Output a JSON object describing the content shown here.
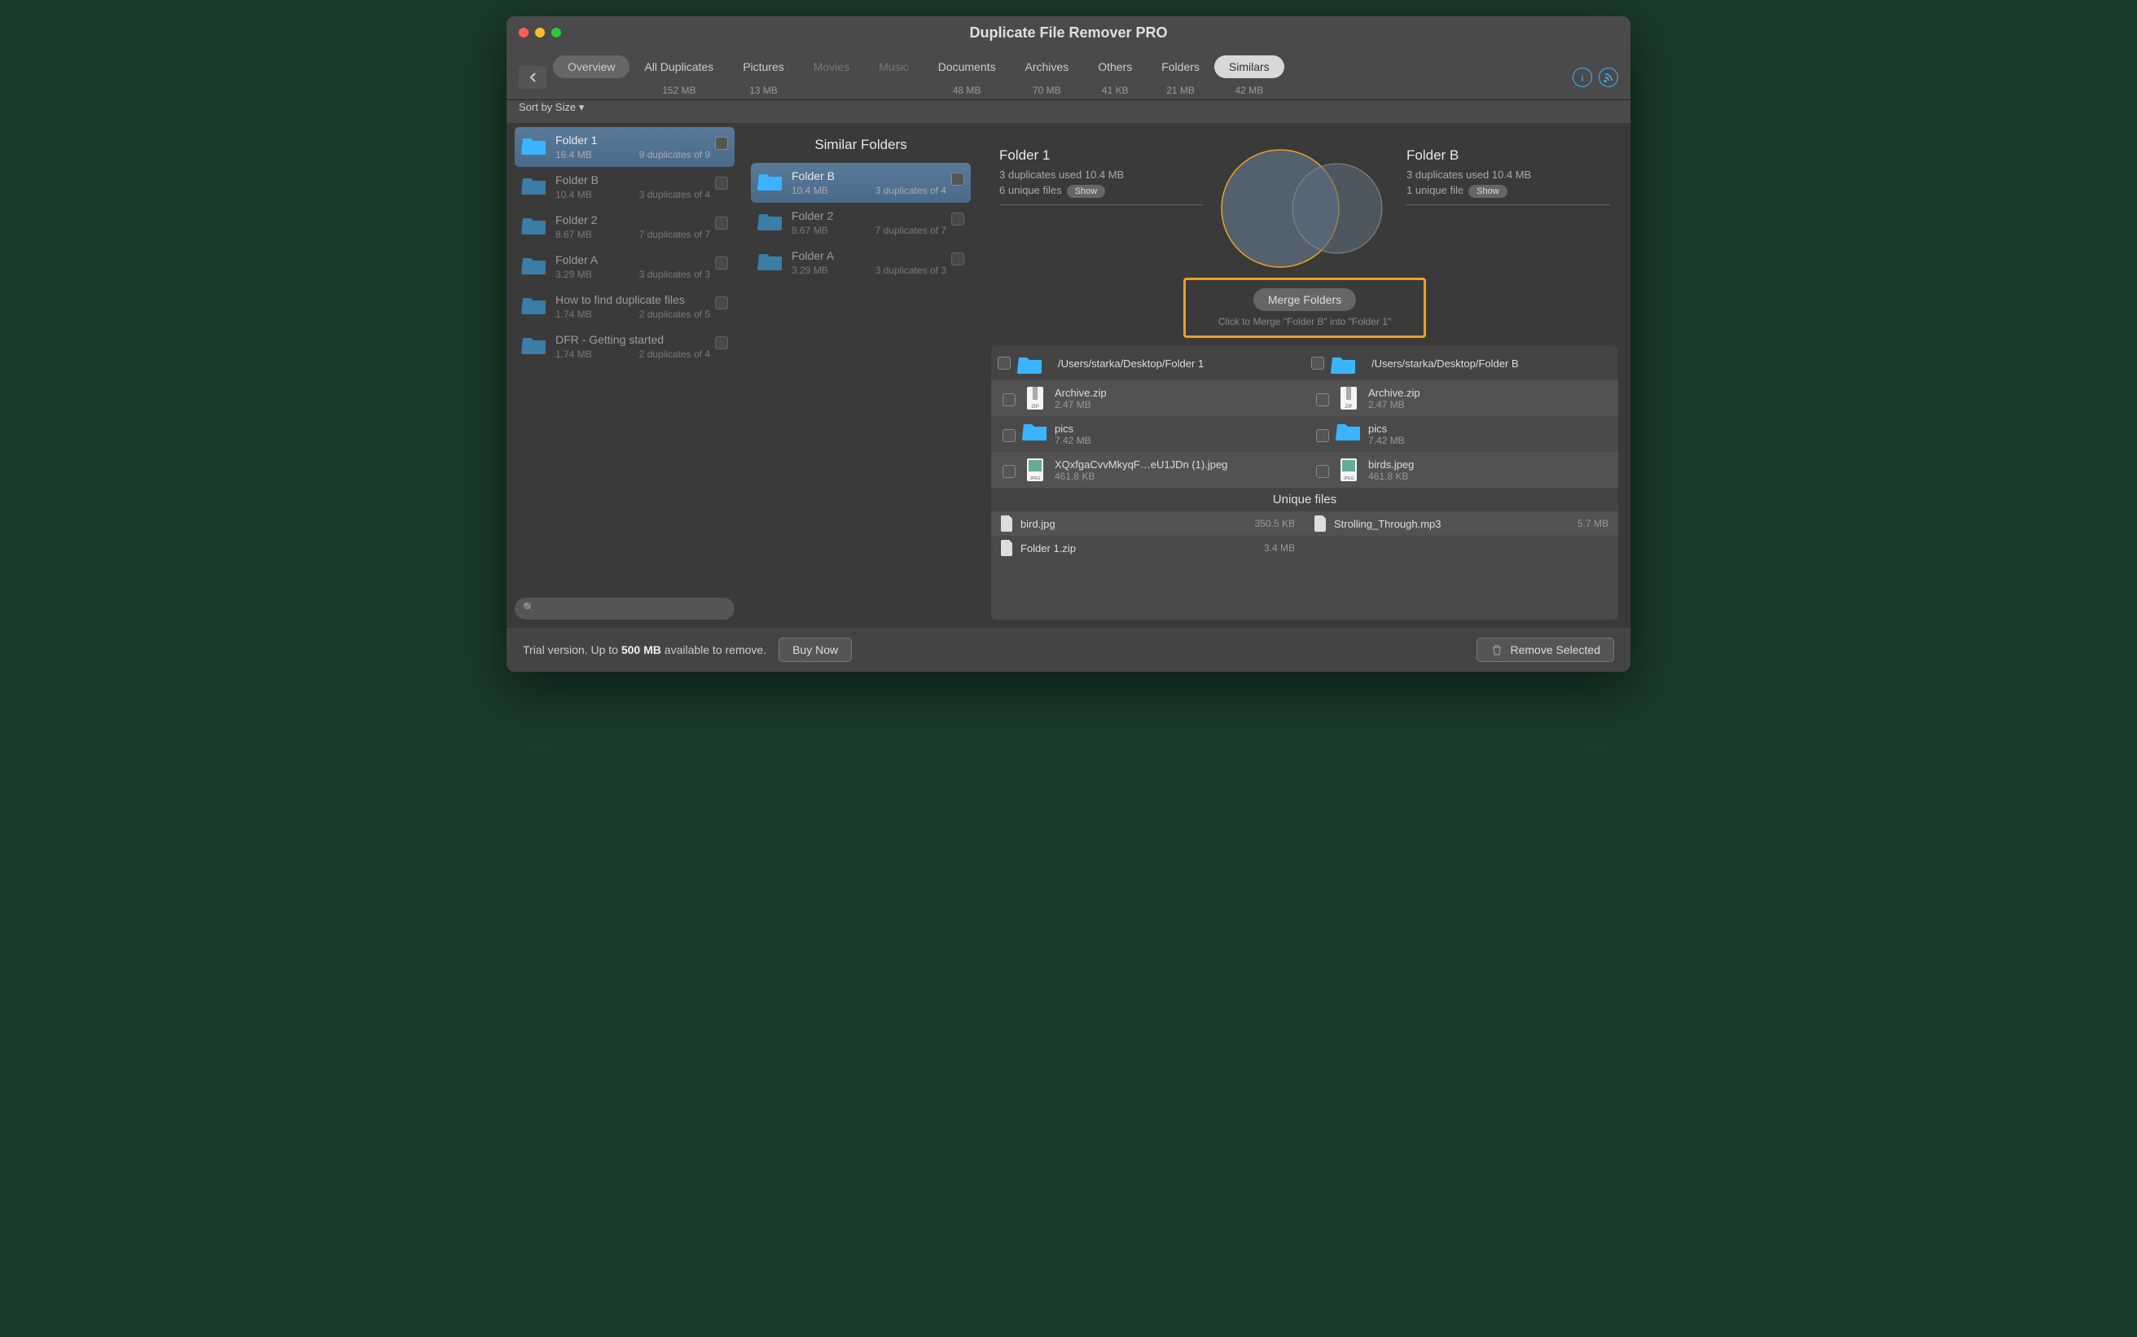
{
  "title": "Duplicate File Remover PRO",
  "sort_label": "Sort by Size ▾",
  "tabs": [
    {
      "label": "Overview",
      "size": "",
      "pill": true
    },
    {
      "label": "All Duplicates",
      "size": "152 MB"
    },
    {
      "label": "Pictures",
      "size": "13 MB"
    },
    {
      "label": "Movies",
      "size": "",
      "dim": true
    },
    {
      "label": "Music",
      "size": "",
      "dim": true
    },
    {
      "label": "Documents",
      "size": "48 MB"
    },
    {
      "label": "Archives",
      "size": "70 MB"
    },
    {
      "label": "Others",
      "size": "41 KB"
    },
    {
      "label": "Folders",
      "size": "21 MB"
    },
    {
      "label": "Similars",
      "size": "42 MB",
      "active": true
    }
  ],
  "sidebar_folders": [
    {
      "name": "Folder 1",
      "size": "16.4 MB",
      "dups": "9 duplicates of 9",
      "selected": true
    },
    {
      "name": "Folder B",
      "size": "10.4 MB",
      "dups": "3 duplicates of 4"
    },
    {
      "name": "Folder 2",
      "size": "8.67 MB",
      "dups": "7 duplicates of 7"
    },
    {
      "name": "Folder A",
      "size": "3.29 MB",
      "dups": "3 duplicates of 3"
    },
    {
      "name": "How to find duplicate files",
      "size": "1.74 MB",
      "dups": "2 duplicates of 5"
    },
    {
      "name": "DFR - Getting started",
      "size": "1.74 MB",
      "dups": "2 duplicates of 4"
    }
  ],
  "middle_title": "Similar Folders",
  "middle_folders": [
    {
      "name": "Folder B",
      "size": "10.4 MB",
      "dups": "3 duplicates of 4",
      "selected": true
    },
    {
      "name": "Folder 2",
      "size": "8.67 MB",
      "dups": "7 duplicates of 7"
    },
    {
      "name": "Folder A",
      "size": "3.29 MB",
      "dups": "3 duplicates of 3"
    }
  ],
  "compare": {
    "left": {
      "title": "Folder 1",
      "dups": "3 duplicates used 10.4 MB",
      "unique": "6 unique files",
      "show": "Show"
    },
    "right": {
      "title": "Folder B",
      "dups": "3 duplicates used 10.4 MB",
      "unique": "1 unique file",
      "show": "Show"
    }
  },
  "merge": {
    "button": "Merge Folders",
    "hint": "Click to Merge \"Folder B\" into \"Folder 1\""
  },
  "paths": {
    "left": "/Users/starka/Desktop/Folder 1",
    "right": "/Users/starka/Desktop/Folder B"
  },
  "dup_files": [
    {
      "left": {
        "name": "Archive.zip",
        "size": "2.47 MB",
        "type": "zip"
      },
      "right": {
        "name": "Archive.zip",
        "size": "2.47 MB",
        "type": "zip"
      }
    },
    {
      "left": {
        "name": "pics",
        "size": "7.42 MB",
        "type": "folder"
      },
      "right": {
        "name": "pics",
        "size": "7.42 MB",
        "type": "folder"
      }
    },
    {
      "left": {
        "name": "XQxfgaCvvMkyqF…eU1JDn (1).jpeg",
        "size": "461.8 KB",
        "type": "jpeg"
      },
      "right": {
        "name": "birds.jpeg",
        "size": "461.8 KB",
        "type": "jpeg"
      }
    }
  ],
  "unique_header": "Unique files",
  "unique_files": {
    "left": [
      {
        "name": "bird.jpg",
        "size": "350.5 KB"
      },
      {
        "name": "Folder 1.zip",
        "size": "3.4 MB"
      }
    ],
    "right": [
      {
        "name": "Strolling_Through.mp3",
        "size": "5.7 MB"
      }
    ]
  },
  "footer": {
    "trial_pre": "Trial version. Up to ",
    "trial_mb": "500 MB",
    "trial_post": " available to remove.",
    "buy": "Buy Now",
    "remove": "Remove Selected"
  }
}
